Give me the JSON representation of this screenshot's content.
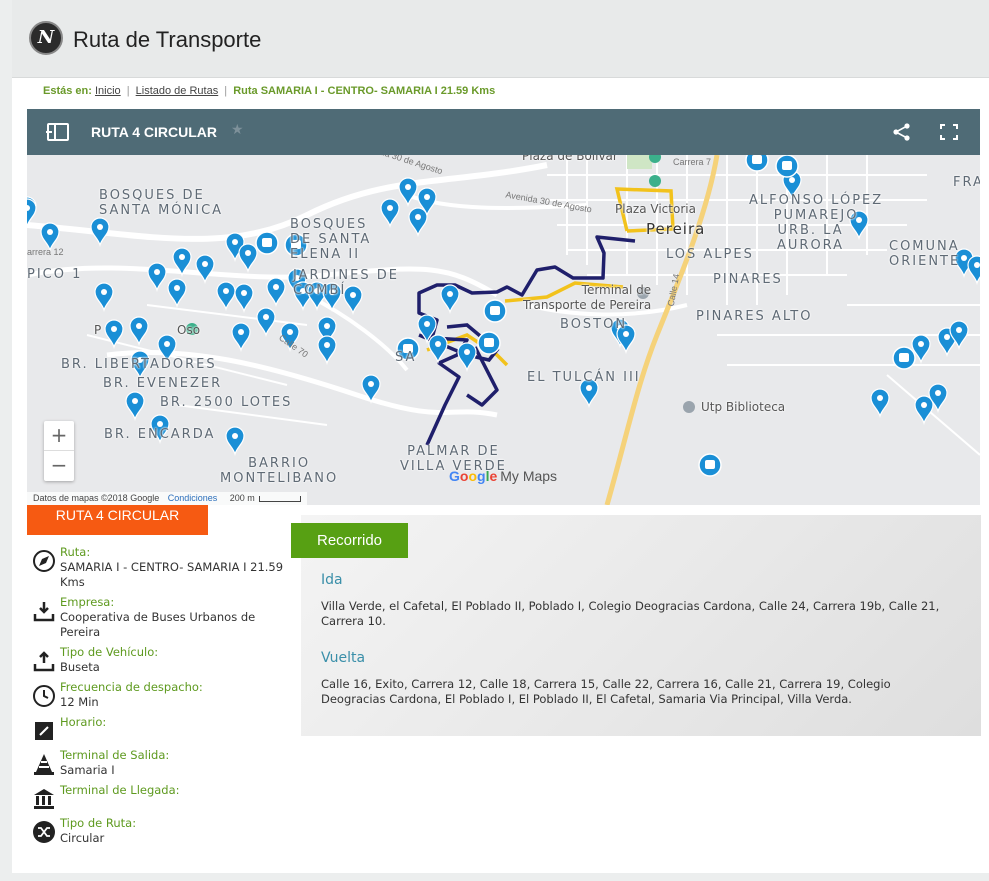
{
  "header": {
    "logo_letter": "N",
    "title": "Ruta de Transporte"
  },
  "breadcrumb": {
    "label": "Estás en:",
    "items": [
      "Inicio",
      "Listado de Rutas"
    ],
    "current": "Ruta SAMARIA I - CENTRO- SAMARIA I 21.59 Kms"
  },
  "map": {
    "title": "RUTA 4 CIRCULAR",
    "brand_google": "Google",
    "brand_mymaps": "My Maps",
    "attribution": "Datos de mapas ©2018 Google",
    "conditions": "Condiciones",
    "scale": "200 m",
    "zoom_in": "+",
    "zoom_out": "−",
    "labels": {
      "bosques_santa_monica": "BOSQUES DE\nSANTA MÓNICA",
      "bosques_santa_elena": "BOSQUES\nDE SANTA\nELENA II",
      "jardines": "JARDINES DE\nCOMBÍ",
      "pico": "PICO 1",
      "libertadores": "BR. LIBERTADORES",
      "evenezer": "BR. EVENEZER",
      "lotes": "BR. 2500 LOTES",
      "encarda": "BR. ENCARDA",
      "montelibano": "BARRIO\nMONTELIBANO",
      "palmar": "PALMAR DE\nVILLA VERDE",
      "tulcan": "EL TULCÁN III",
      "boston": "BOSTON",
      "los_alpes": "LOS ALPES",
      "pinares": "PINARES",
      "pinares_alto": "PINARES ALTO",
      "alfonso": "ALFONSO LÓPEZ\nPUMAREJO",
      "urb_aurora": "URB. LA\nAURORA",
      "comuna": "COMUNA\nORIENTE",
      "fra": "FRA",
      "pereira": "Pereira",
      "plaza_victoria": "Plaza Victoria",
      "plaza_bolivar": "Plaza de Bolívar",
      "terminal": "Terminal de\nTransporte de Pereira",
      "utp": "Utp Biblioteca",
      "oso": "Oso",
      "av30_1": "Avenida 30 de Agosto",
      "av30_2": "Avenida 30 de Agosto",
      "carrera7": "Carrera 7",
      "calle14": "Calle 14",
      "calle70": "Calle 70",
      "carrera12": "arrera 12",
      "sa": "SA",
      "p_label": "P"
    }
  },
  "route_tab": "RUTA 4 CIRCULAR",
  "details": [
    {
      "key": "Ruta:",
      "value": "SAMARIA I - CENTRO- SAMARIA I 21.59 Kms",
      "icon": "compass-icon"
    },
    {
      "key": "Empresa:",
      "value": "Cooperativa de Buses Urbanos de Pereira",
      "icon": "download-tray-icon"
    },
    {
      "key": "Tipo de Vehículo:",
      "value": "Buseta",
      "icon": "upload-tray-icon"
    },
    {
      "key": "Frecuencia de despacho:",
      "value": "12 Min",
      "icon": "clock-icon"
    },
    {
      "key": "Horario:",
      "value": "",
      "icon": "edit-icon"
    },
    {
      "key": "Terminal de Salida:",
      "value": "Samaria I",
      "icon": "cone-icon"
    },
    {
      "key": "Terminal de Llegada:",
      "value": "",
      "icon": "bank-icon"
    },
    {
      "key": "Tipo de Ruta:",
      "value": "Circular",
      "icon": "shuffle-icon"
    }
  ],
  "recorrido": {
    "label": "Recorrido",
    "ida_title": "Ida",
    "ida_text": "Villa Verde, el Cafetal, El Poblado II, Poblado I, Colegio Deogracias Cardona, Calle 24, Carrera 19b, Calle 21, Carrera 10.",
    "vuelta_title": "Vuelta",
    "vuelta_text": "Calle 16, Exito, Carrera 12, Calle 18, Carrera 15, Calle 22, Carrera 16, Calle 21, Carrera 19, Colegio Deogracias Cardona, El Poblado I, El Poblado II, El Cafetal, Samaria Via Principal, Villa Verda."
  },
  "colors": {
    "map_header": "#4f6b76",
    "route_blue": "#1f1f6b",
    "route_yellow": "#f2c21b",
    "pin_blue": "#1a8fd6",
    "orange": "#f65a12",
    "green": "#57a013",
    "label_green": "#5e9a1f",
    "title_teal": "#3a8fa9"
  }
}
